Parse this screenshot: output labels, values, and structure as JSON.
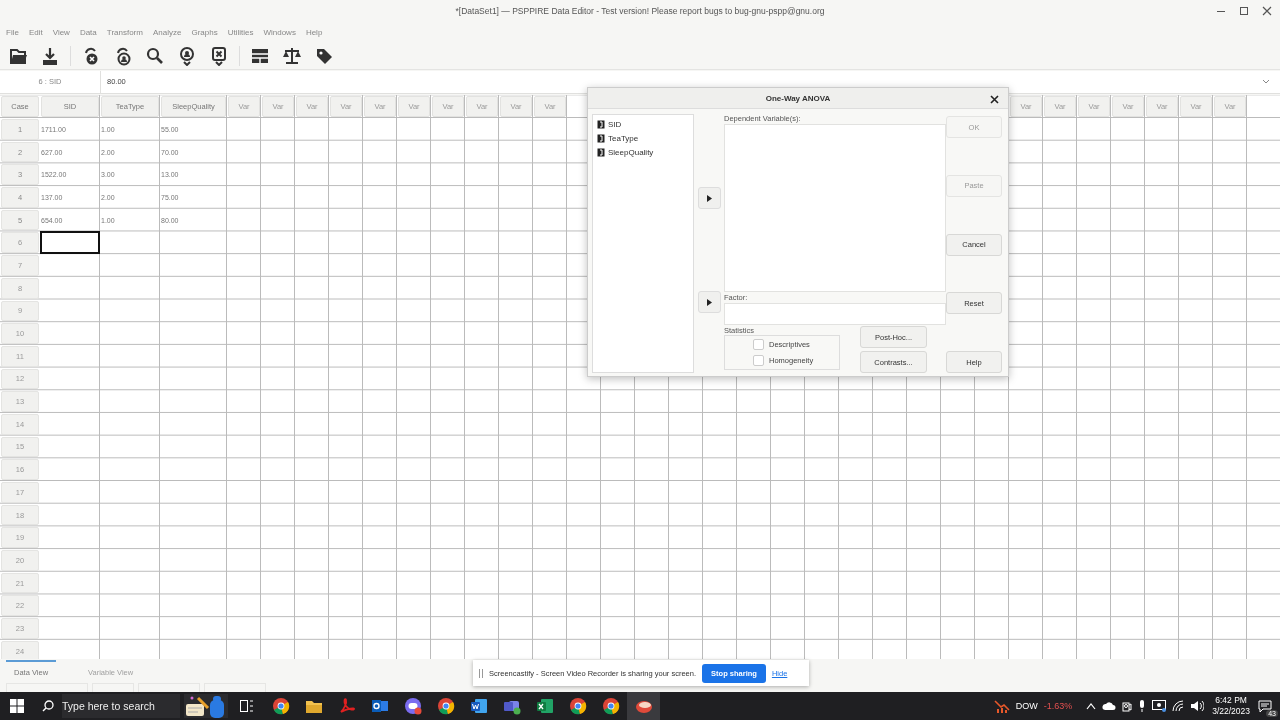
{
  "window": {
    "title": "*[DataSet1] — PSPPIRE Data Editor - Test version! Please report bugs to bug-gnu-pspp@gnu.org"
  },
  "menu": [
    "File",
    "Edit",
    "View",
    "Data",
    "Transform",
    "Analyze",
    "Graphs",
    "Utilities",
    "Windows",
    "Help"
  ],
  "toolbar": [
    {
      "kind": "open"
    },
    {
      "kind": "save"
    },
    {
      "kind": "goto-case"
    },
    {
      "kind": "goto-variable"
    },
    {
      "kind": "find"
    },
    {
      "kind": "insert-case"
    },
    {
      "kind": "delete-case"
    },
    {
      "kind": "split"
    },
    {
      "kind": "weight"
    },
    {
      "kind": "labels"
    }
  ],
  "reference": {
    "cell": "6 : SID",
    "value": "80.00"
  },
  "grid": {
    "case_header": "Case",
    "columns": [
      "SID",
      "TeaType",
      "SleepQuality"
    ],
    "vacant_left": [
      "Var",
      "Var",
      "Var",
      "Var",
      "Var",
      "Var",
      "Var",
      "Var",
      "Var",
      "Var"
    ],
    "vacant_right": [
      "Var",
      "Var",
      "Var",
      "Var",
      "Var",
      "Var",
      "Var"
    ],
    "rows": [
      {
        "case": "1",
        "cells": [
          "1711.00",
          "1.00",
          "55.00"
        ],
        "selected": false
      },
      {
        "case": "2",
        "cells": [
          "627.00",
          "2.00",
          "70.00"
        ],
        "selected": false
      },
      {
        "case": "3",
        "cells": [
          "1522.00",
          "3.00",
          "13.00"
        ],
        "selected": false
      },
      {
        "case": "4",
        "cells": [
          "137.00",
          "2.00",
          "75.00"
        ],
        "selected": false
      },
      {
        "case": "5",
        "cells": [
          "654.00",
          "1.00",
          "80.00"
        ],
        "selected": false
      },
      {
        "case": "6",
        "cells": [],
        "selected": true
      },
      {
        "case": "7",
        "cells": [],
        "selected": false
      },
      {
        "case": "8",
        "cells": [],
        "selected": false
      },
      {
        "case": "9",
        "cells": [],
        "selected": false
      },
      {
        "case": "10",
        "cells": [],
        "selected": false
      },
      {
        "case": "11",
        "cells": [],
        "selected": false
      },
      {
        "case": "12",
        "cells": [],
        "selected": false
      },
      {
        "case": "13",
        "cells": [],
        "selected": false
      },
      {
        "case": "14",
        "cells": [],
        "selected": false
      },
      {
        "case": "15",
        "cells": [],
        "selected": false
      },
      {
        "case": "16",
        "cells": [],
        "selected": false
      },
      {
        "case": "17",
        "cells": [],
        "selected": false
      },
      {
        "case": "18",
        "cells": [],
        "selected": false
      },
      {
        "case": "19",
        "cells": [],
        "selected": false
      },
      {
        "case": "20",
        "cells": [],
        "selected": false
      },
      {
        "case": "21",
        "cells": [],
        "selected": false
      },
      {
        "case": "22",
        "cells": [],
        "selected": false
      },
      {
        "case": "23",
        "cells": [],
        "selected": false
      },
      {
        "case": "24",
        "cells": [],
        "selected": false
      }
    ]
  },
  "view_tabs": [
    {
      "label": "Data View",
      "selected": true
    },
    {
      "label": "Variable View",
      "selected": false
    }
  ],
  "dialog": {
    "title": "One-Way ANOVA",
    "variables": [
      "SID",
      "TeaType",
      "SleepQuality"
    ],
    "dependent_label": "Dependent Variable(s):",
    "factor_label": "Factor:",
    "statistics_label": "Statistics",
    "statistics": [
      {
        "label": "Descriptives",
        "checked": false
      },
      {
        "label": "Homogeneity",
        "checked": false
      }
    ],
    "option_buttons": [
      "Post-Hoc...",
      "Contrasts..."
    ],
    "buttons": [
      {
        "label": "OK",
        "disabled": true
      },
      {
        "label": "Paste",
        "disabled": true
      },
      {
        "label": "Cancel",
        "disabled": false
      },
      {
        "label": "Reset",
        "disabled": false
      },
      {
        "label": "Help",
        "disabled": false
      }
    ]
  },
  "notification": {
    "message": "Screencastify - Screen Video Recorder is sharing your screen.",
    "button": "Stop sharing",
    "link": "Hide"
  },
  "taskbar": {
    "search_placeholder": "Type here to search",
    "apps": [
      {
        "kind": "browser",
        "active": false
      },
      {
        "kind": "folder",
        "active": false
      },
      {
        "kind": "pdf",
        "active": false
      },
      {
        "kind": "mail",
        "active": false
      },
      {
        "kind": "chat",
        "active": false
      },
      {
        "kind": "browser",
        "active": false
      },
      {
        "kind": "word",
        "active": false
      },
      {
        "kind": "teams",
        "active": false
      },
      {
        "kind": "excel",
        "active": false
      },
      {
        "kind": "browser",
        "active": false
      },
      {
        "kind": "browser",
        "active": false
      },
      {
        "kind": "app",
        "active": true
      }
    ],
    "ticker": {
      "name": "DOW",
      "change": "-1.63%"
    },
    "time": "6:42 PM",
    "date": "3/22/2023",
    "notifications": "43"
  }
}
